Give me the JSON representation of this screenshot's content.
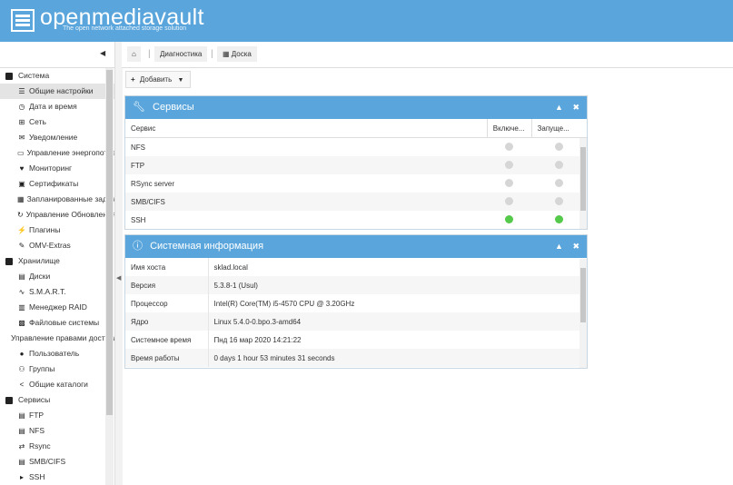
{
  "app": {
    "logo_text": "openmediavault",
    "tagline": "The open network attached storage solution"
  },
  "breadcrumb": {
    "items": [
      "Диагностика",
      "Доска"
    ]
  },
  "toolbar": {
    "add_label": "Добавить"
  },
  "sidebar": {
    "groups": [
      {
        "label": "Система",
        "items": [
          {
            "label": "Общие настройки",
            "icon": "sliders-icon",
            "glyph": "☰",
            "selected": true
          },
          {
            "label": "Дата и время",
            "icon": "clock-icon",
            "glyph": "◷"
          },
          {
            "label": "Сеть",
            "icon": "network-icon",
            "glyph": "⊞"
          },
          {
            "label": "Уведомление",
            "icon": "envelope-icon",
            "glyph": "✉"
          },
          {
            "label": "Управление энергопотреблением",
            "icon": "battery-icon",
            "glyph": "▭"
          },
          {
            "label": "Мониторинг",
            "icon": "heartbeat-icon",
            "glyph": "♥"
          },
          {
            "label": "Сертификаты",
            "icon": "certificate-icon",
            "glyph": "▣"
          },
          {
            "label": "Запланированные задачи",
            "icon": "calendar-icon",
            "glyph": "▦"
          },
          {
            "label": "Управление Обновлениями",
            "icon": "refresh-icon",
            "glyph": "↻"
          },
          {
            "label": "Плагины",
            "icon": "plug-icon",
            "glyph": "⚡"
          },
          {
            "label": "OMV-Extras",
            "icon": "wrench-icon",
            "glyph": "✎"
          }
        ]
      },
      {
        "label": "Хранилище",
        "items": [
          {
            "label": "Диски",
            "icon": "hdd-icon",
            "glyph": "▤"
          },
          {
            "label": "S.M.A.R.T.",
            "icon": "smart-icon",
            "glyph": "∿"
          },
          {
            "label": "Менеджер RAID",
            "icon": "raid-icon",
            "glyph": "▥"
          },
          {
            "label": "Файловые системы",
            "icon": "filesystem-icon",
            "glyph": "▩"
          }
        ]
      },
      {
        "label": "Управление правами доступа",
        "items": [
          {
            "label": "Пользователь",
            "icon": "user-icon",
            "glyph": "●"
          },
          {
            "label": "Группы",
            "icon": "group-icon",
            "glyph": "⚇"
          },
          {
            "label": "Общие каталоги",
            "icon": "share-icon",
            "glyph": "<"
          }
        ]
      },
      {
        "label": "Сервисы",
        "items": [
          {
            "label": "FTP",
            "icon": "ftp-icon",
            "glyph": "▤"
          },
          {
            "label": "NFS",
            "icon": "nfs-icon",
            "glyph": "▤"
          },
          {
            "label": "Rsync",
            "icon": "rsync-icon",
            "glyph": "⇄"
          },
          {
            "label": "SMB/CIFS",
            "icon": "smb-icon",
            "glyph": "▤"
          },
          {
            "label": "SSH",
            "icon": "terminal-icon",
            "glyph": "▸"
          }
        ]
      }
    ]
  },
  "services_panel": {
    "title": "Сервисы",
    "columns": [
      "Сервис",
      "Включе...",
      "Запуще..."
    ],
    "rows": [
      {
        "name": "NFS",
        "enabled": false,
        "running": false
      },
      {
        "name": "FTP",
        "enabled": false,
        "running": false
      },
      {
        "name": "RSync server",
        "enabled": false,
        "running": false
      },
      {
        "name": "SMB/CIFS",
        "enabled": false,
        "running": false
      },
      {
        "name": "SSH",
        "enabled": true,
        "running": true
      }
    ]
  },
  "sysinfo_panel": {
    "title": "Системная информация",
    "rows": [
      [
        "Имя хоста",
        "sklad.local"
      ],
      [
        "Версия",
        "5.3.8-1 (Usul)"
      ],
      [
        "Процессор",
        "Intel(R) Core(TM) i5-4570 CPU @ 3.20GHz"
      ],
      [
        "Ядро",
        "Linux 5.4.0-0.bpo.3-amd64"
      ],
      [
        "Системное время",
        "Пнд 16 мар 2020 14:21:22"
      ],
      [
        "Время работы",
        "0 days 1 hour 53 minutes 31 seconds"
      ]
    ]
  },
  "colors": {
    "header": "#5aa6dc",
    "status_on": "#55c94a",
    "status_off": "#d6d6d6"
  }
}
